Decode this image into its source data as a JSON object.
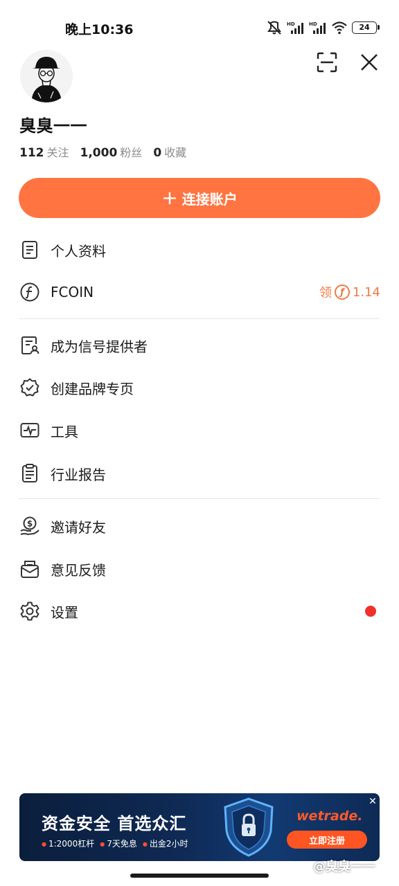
{
  "status_bar": {
    "time": "晚上10:36",
    "battery": "24"
  },
  "profile": {
    "username": "臭臭一一",
    "stats": [
      {
        "value": "112",
        "label": "关注"
      },
      {
        "value": "1,000",
        "label": "粉丝"
      },
      {
        "value": "0",
        "label": "收藏"
      }
    ],
    "connect_button": {
      "icon": "+",
      "label": "连接账户"
    }
  },
  "menu": {
    "group1": [
      {
        "label": "个人资料",
        "icon": "document-icon"
      },
      {
        "label": "FCOIN",
        "icon": "fcoin-icon",
        "claim_label": "领",
        "claim_value": "1.14"
      }
    ],
    "group2": [
      {
        "label": "成为信号提供者",
        "icon": "signal-provider-icon"
      },
      {
        "label": "创建品牌专页",
        "icon": "verified-badge-icon"
      },
      {
        "label": "工具",
        "icon": "pulse-monitor-icon"
      },
      {
        "label": "行业报告",
        "icon": "clipboard-report-icon"
      }
    ],
    "group3": [
      {
        "label": "邀请好友",
        "icon": "invite-money-icon"
      },
      {
        "label": "意见反馈",
        "icon": "feedback-mail-icon"
      },
      {
        "label": "设置",
        "icon": "gear-icon",
        "has_notification": true
      }
    ]
  },
  "ad": {
    "title": "资金安全 首选众汇",
    "bullets": [
      "1:2000杠杆",
      "7天免息",
      "出金2小时"
    ],
    "brand": "wetrade.",
    "cta": "立即注册",
    "close": "✕"
  },
  "watermark": "@臭臭一一",
  "colors": {
    "accent": "#ff7440",
    "fcoin": "#f07a45",
    "notification": "#f0302a"
  }
}
